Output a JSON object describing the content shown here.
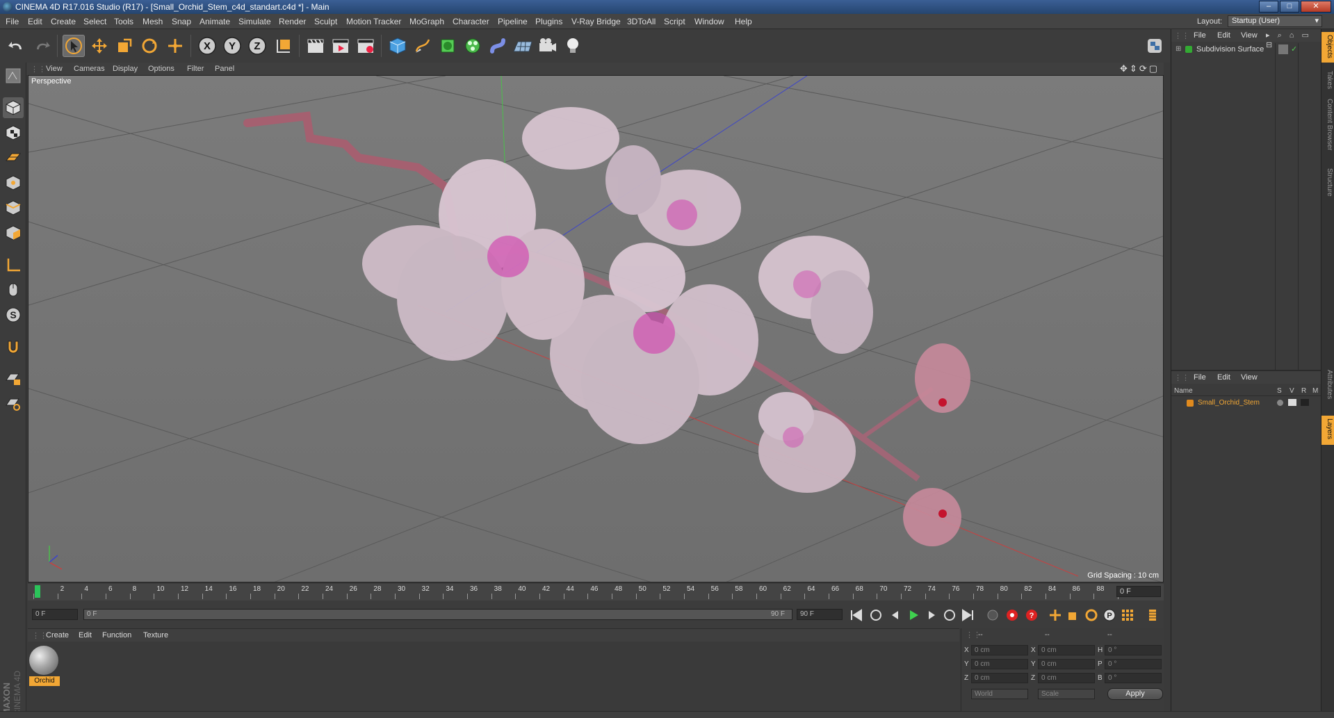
{
  "window": {
    "title": "CINEMA 4D R17.016 Studio (R17) - [Small_Orchid_Stem_c4d_standart.c4d *] - Main"
  },
  "menubar": {
    "items": [
      "File",
      "Edit",
      "Create",
      "Select",
      "Tools",
      "Mesh",
      "Snap",
      "Animate",
      "Simulate",
      "Render",
      "Sculpt",
      "Motion Tracker",
      "MoGraph",
      "Character",
      "Pipeline",
      "Plugins",
      "V-Ray Bridge",
      "3DToAll",
      "Script",
      "Window",
      "Help"
    ],
    "layout_label": "Layout:",
    "layout_value": "Startup (User)"
  },
  "viewport": {
    "menu": [
      "View",
      "Cameras",
      "Display",
      "Options",
      "Filter",
      "Panel"
    ],
    "label": "Perspective",
    "grid_spacing": "Grid Spacing : 10 cm"
  },
  "timeline": {
    "ticks": [
      "0",
      "2",
      "4",
      "6",
      "8",
      "10",
      "12",
      "14",
      "16",
      "18",
      "20",
      "22",
      "24",
      "26",
      "28",
      "30",
      "32",
      "34",
      "36",
      "38",
      "40",
      "42",
      "44",
      "46",
      "48",
      "50",
      "52",
      "54",
      "56",
      "58",
      "60",
      "62",
      "64",
      "66",
      "68",
      "70",
      "72",
      "74",
      "76",
      "78",
      "80",
      "82",
      "84",
      "86",
      "88",
      "90"
    ],
    "current_frame": "0 F"
  },
  "transport": {
    "start": "0 F",
    "range_start": "0 F",
    "range_end": "90 F",
    "end": "90 F"
  },
  "material_panel": {
    "menu": [
      "Create",
      "Edit",
      "Function",
      "Texture"
    ],
    "materials": [
      {
        "name": "Orchid"
      }
    ]
  },
  "coords": {
    "headers": [
      "--",
      "--",
      "--"
    ],
    "rows": [
      {
        "l1": "X",
        "v1": "0 cm",
        "l2": "X",
        "v2": "0 cm",
        "l3": "H",
        "v3": "0 °"
      },
      {
        "l1": "Y",
        "v1": "0 cm",
        "l2": "Y",
        "v2": "0 cm",
        "l3": "P",
        "v3": "0 °"
      },
      {
        "l1": "Z",
        "v1": "0 cm",
        "l2": "Z",
        "v2": "0 cm",
        "l3": "B",
        "v3": "0 °"
      }
    ],
    "world": "World",
    "scale": "Scale",
    "apply": "Apply"
  },
  "object_manager": {
    "menu": [
      "File",
      "Edit",
      "View"
    ],
    "objects": [
      {
        "name": "Subdivision Surface"
      }
    ]
  },
  "layer_manager": {
    "menu": [
      "File",
      "Edit",
      "View"
    ],
    "columns": {
      "name": "Name",
      "s": "S",
      "v": "V",
      "r": "R",
      "m": "M"
    },
    "items": [
      {
        "name": "Small_Orchid_Stem"
      }
    ]
  },
  "side_tabs": [
    "Objects",
    "Takes",
    "Content Browser",
    "Structure",
    "Attributes",
    "Layers"
  ],
  "brand": {
    "maxon": "MAXON",
    "c4d": "CINEMA 4D"
  },
  "colors": {
    "accent": "#f2a735",
    "selection_orange": "#e08a1e",
    "bg": "#3a3a3a"
  }
}
